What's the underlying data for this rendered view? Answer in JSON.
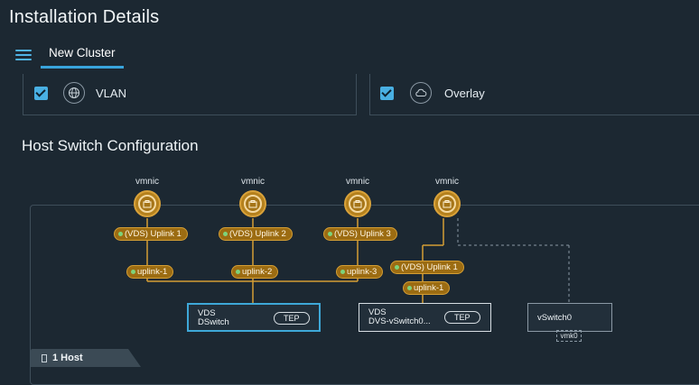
{
  "header": {
    "title": "Installation Details"
  },
  "tabs": [
    {
      "label": "New Cluster"
    }
  ],
  "cards": [
    {
      "label": "VLAN",
      "icon": "globe-icon",
      "checked": true
    },
    {
      "label": "Overlay",
      "icon": "cloud-icon",
      "checked": true
    }
  ],
  "section": {
    "title": "Host Switch Configuration"
  },
  "vmnics": [
    {
      "label": "vmnic"
    },
    {
      "label": "vmnic"
    },
    {
      "label": "vmnic"
    },
    {
      "label": "vmnic"
    }
  ],
  "vds_uplinks": [
    {
      "label": "(VDS) Uplink 1"
    },
    {
      "label": "(VDS) Uplink 2"
    },
    {
      "label": "(VDS) Uplink 3"
    },
    {
      "label": "(VDS) Uplink 1"
    }
  ],
  "uplinks": [
    {
      "label": "uplink-1"
    },
    {
      "label": "uplink-2"
    },
    {
      "label": "uplink-3"
    },
    {
      "label": "uplink-1"
    }
  ],
  "switches": [
    {
      "type": "VDS",
      "name": "DSwitch",
      "badge": "TEP"
    },
    {
      "type": "VDS",
      "name": "DVS-vSwitch0...",
      "badge": "TEP"
    },
    {
      "type": "",
      "name": "vSwitch0",
      "badge": ""
    }
  ],
  "vmk": {
    "label": "vmk0"
  },
  "host_tab": {
    "label": "1 Host"
  },
  "colors": {
    "accent": "#39a4dc",
    "uplink_fill": "#9c6c12",
    "uplink_border": "#d49e34",
    "status_dot": "#7ed37a",
    "vds_border_primary": "#3ea8d8",
    "vds_border_secondary": "#d7dee3"
  }
}
